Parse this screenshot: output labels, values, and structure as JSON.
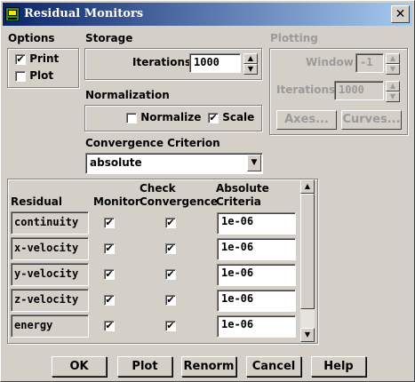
{
  "window": {
    "title": "Residual Monitors",
    "close_glyph": "✕"
  },
  "options": {
    "heading": "Options",
    "print_label": "Print",
    "print_checked": true,
    "plot_label": "Plot",
    "plot_checked": false
  },
  "storage": {
    "heading": "Storage",
    "iterations_label": "Iterations",
    "iterations_value": "1000"
  },
  "plotting": {
    "heading": "Plotting",
    "window_label": "Window",
    "window_value": "-1",
    "iterations_label": "Iterations",
    "iterations_value": "1000",
    "axes_label": "Axes...",
    "curves_label": "Curves..."
  },
  "normalization": {
    "heading": "Normalization",
    "normalize_label": "Normalize",
    "normalize_checked": false,
    "scale_label": "Scale",
    "scale_checked": true
  },
  "convergence": {
    "heading": "Convergence Criterion",
    "selected": "absolute"
  },
  "table": {
    "headers": {
      "residual": "Residual",
      "monitor": "Monitor",
      "check_line1": "Check",
      "check_line2": "Convergence",
      "abs_line1": "Absolute",
      "abs_line2": "Criteria"
    },
    "rows": [
      {
        "name": "continuity",
        "monitor": true,
        "check": true,
        "criteria": "1e-06"
      },
      {
        "name": "x-velocity",
        "monitor": true,
        "check": true,
        "criteria": "1e-06"
      },
      {
        "name": "y-velocity",
        "monitor": true,
        "check": true,
        "criteria": "1e-06"
      },
      {
        "name": "z-velocity",
        "monitor": true,
        "check": true,
        "criteria": "1e-06"
      },
      {
        "name": "energy",
        "monitor": true,
        "check": true,
        "criteria": "1e-06"
      }
    ]
  },
  "buttons": {
    "ok": "OK",
    "plot": "Plot",
    "renorm": "Renorm",
    "cancel": "Cancel",
    "help": "Help"
  },
  "glyphs": {
    "check": "✔",
    "up": "▲",
    "down": "▼"
  }
}
